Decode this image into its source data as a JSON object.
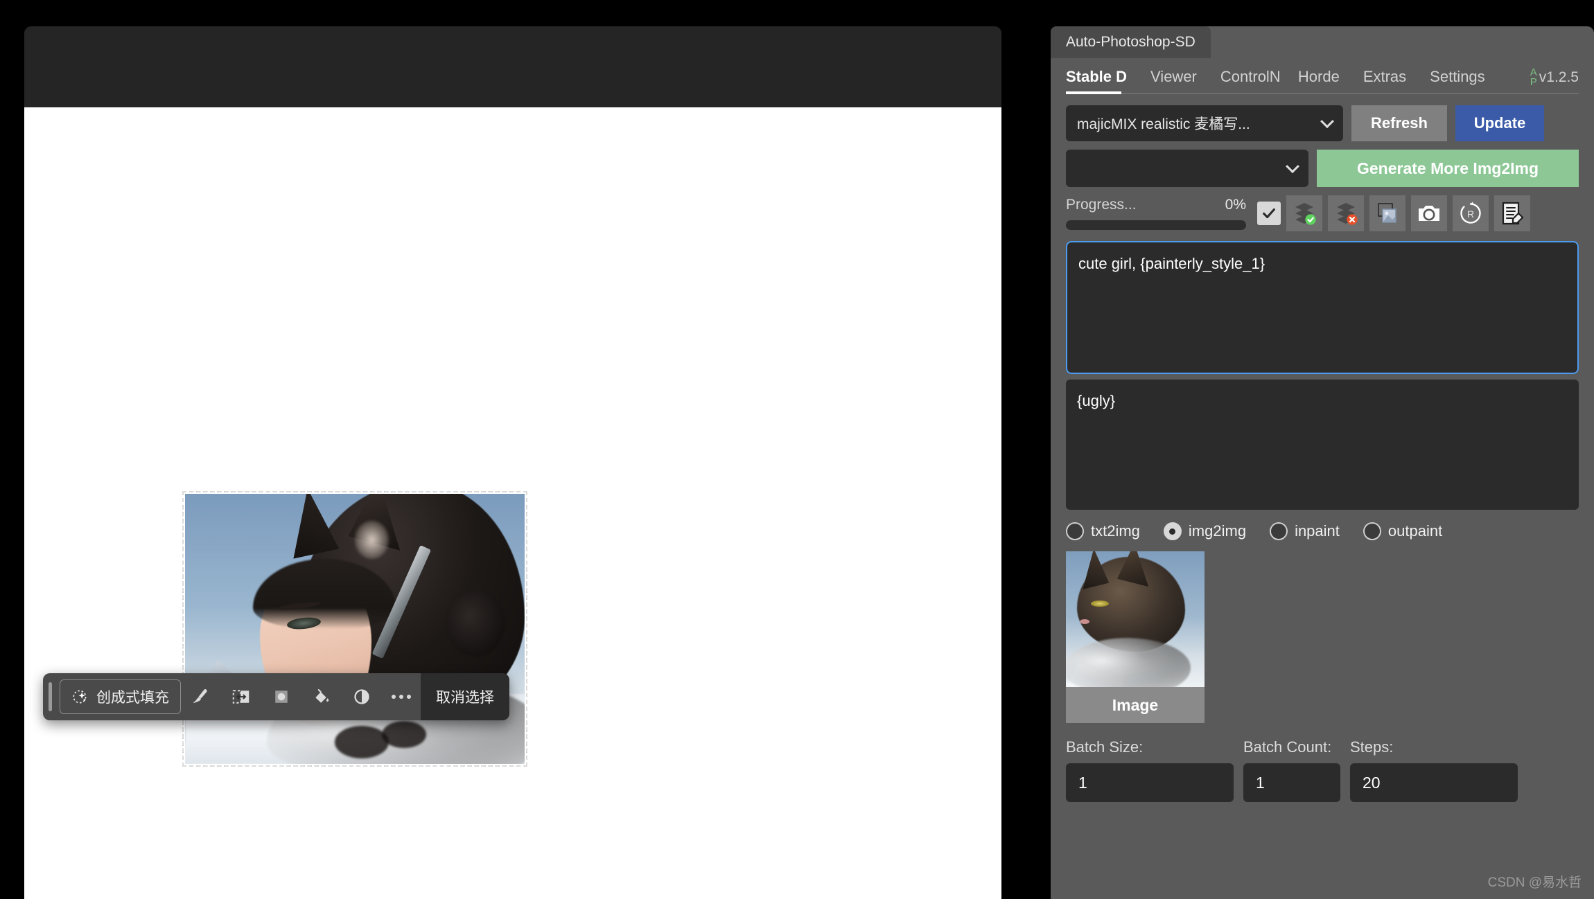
{
  "panel": {
    "tab_title": "Auto-Photoshop-SD",
    "nav": [
      {
        "label": "Stable D",
        "active": true
      },
      {
        "label": "Viewer",
        "active": false
      },
      {
        "label": "ControlN",
        "active": false
      },
      {
        "label": "Horde",
        "active": false
      },
      {
        "label": "Extras",
        "active": false
      },
      {
        "label": "Settings",
        "active": false
      }
    ],
    "logo_top": "A",
    "logo_bottom": "P",
    "version": "v1.2.5",
    "model_select": "majicMIX realistic 麦橘写...",
    "lora_select": "",
    "refresh_label": "Refresh",
    "update_label": "Update",
    "generate_label": "Generate More Img2Img",
    "progress_label": "Progress...",
    "progress_percent": "0%",
    "progress_value": 0,
    "icons": [
      "checkbox-checked",
      "layers-accept-icon",
      "layers-reject-icon",
      "image-frame-icon",
      "camera-icon",
      "refresh-r-icon",
      "document-edit-icon"
    ],
    "prompt_positive": "cute girl, {painterly_style_1}",
    "prompt_negative": "{ugly}",
    "modes": [
      {
        "label": "txt2img",
        "selected": false
      },
      {
        "label": "img2img",
        "selected": true
      },
      {
        "label": "inpaint",
        "selected": false
      },
      {
        "label": "outpaint",
        "selected": false
      }
    ],
    "thumbnail_caption": "Image",
    "fields": [
      {
        "label": "Batch Size:",
        "value": "1"
      },
      {
        "label": "Batch Count:",
        "value": "1"
      },
      {
        "label": "Steps:",
        "value": "20"
      }
    ],
    "accent_blue": "#3b5ba8",
    "accent_green": "#8cc795",
    "focus_blue": "#4d9bf0"
  },
  "photoshop": {
    "toolbar": {
      "generative_fill_label": "创成式填充",
      "deselect_label": "取消选择",
      "icons": [
        "sparkle-icon",
        "brush-icon",
        "select-and-mask-icon",
        "mask-icon",
        "paint-bucket-icon",
        "adjustment-icon",
        "more-options-icon"
      ]
    }
  },
  "watermark": "CSDN @易水哲"
}
